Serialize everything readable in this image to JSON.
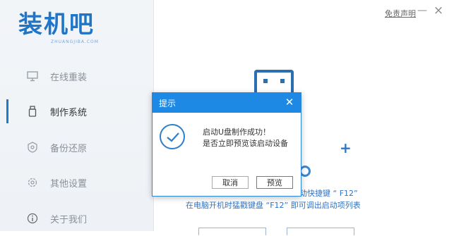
{
  "app": {
    "logo_text": "装机吧",
    "logo_sub": "ZHUANGJIBA.COM",
    "disclaimer_link": "免责声明",
    "minimize_glyph": "—",
    "close_glyph": "×"
  },
  "sidebar": {
    "items": [
      {
        "label": "在线重装",
        "icon": "monitor-icon",
        "active": false
      },
      {
        "label": "制作系统",
        "icon": "usb-drive-icon",
        "active": true
      },
      {
        "label": "备份还原",
        "icon": "backup-icon",
        "active": false
      },
      {
        "label": "其他设置",
        "icon": "settings-icon",
        "active": false
      },
      {
        "label": "关于我们",
        "icon": "info-icon",
        "active": false
      }
    ]
  },
  "main": {
    "hint_line_1_suffix": "动快捷键 “ F12”",
    "hint_line_2": "在电脑开机时猛戳键盘 “F12” 即可调出启动项列表"
  },
  "dialog": {
    "title": "提示",
    "close_glyph": "✕",
    "message_line_1": "启动U盘制作成功！",
    "message_line_2": "是否立即预览该启动设备",
    "cancel_label": "取消",
    "preview_label": "预览",
    "accent_color": "#1e88e5"
  }
}
